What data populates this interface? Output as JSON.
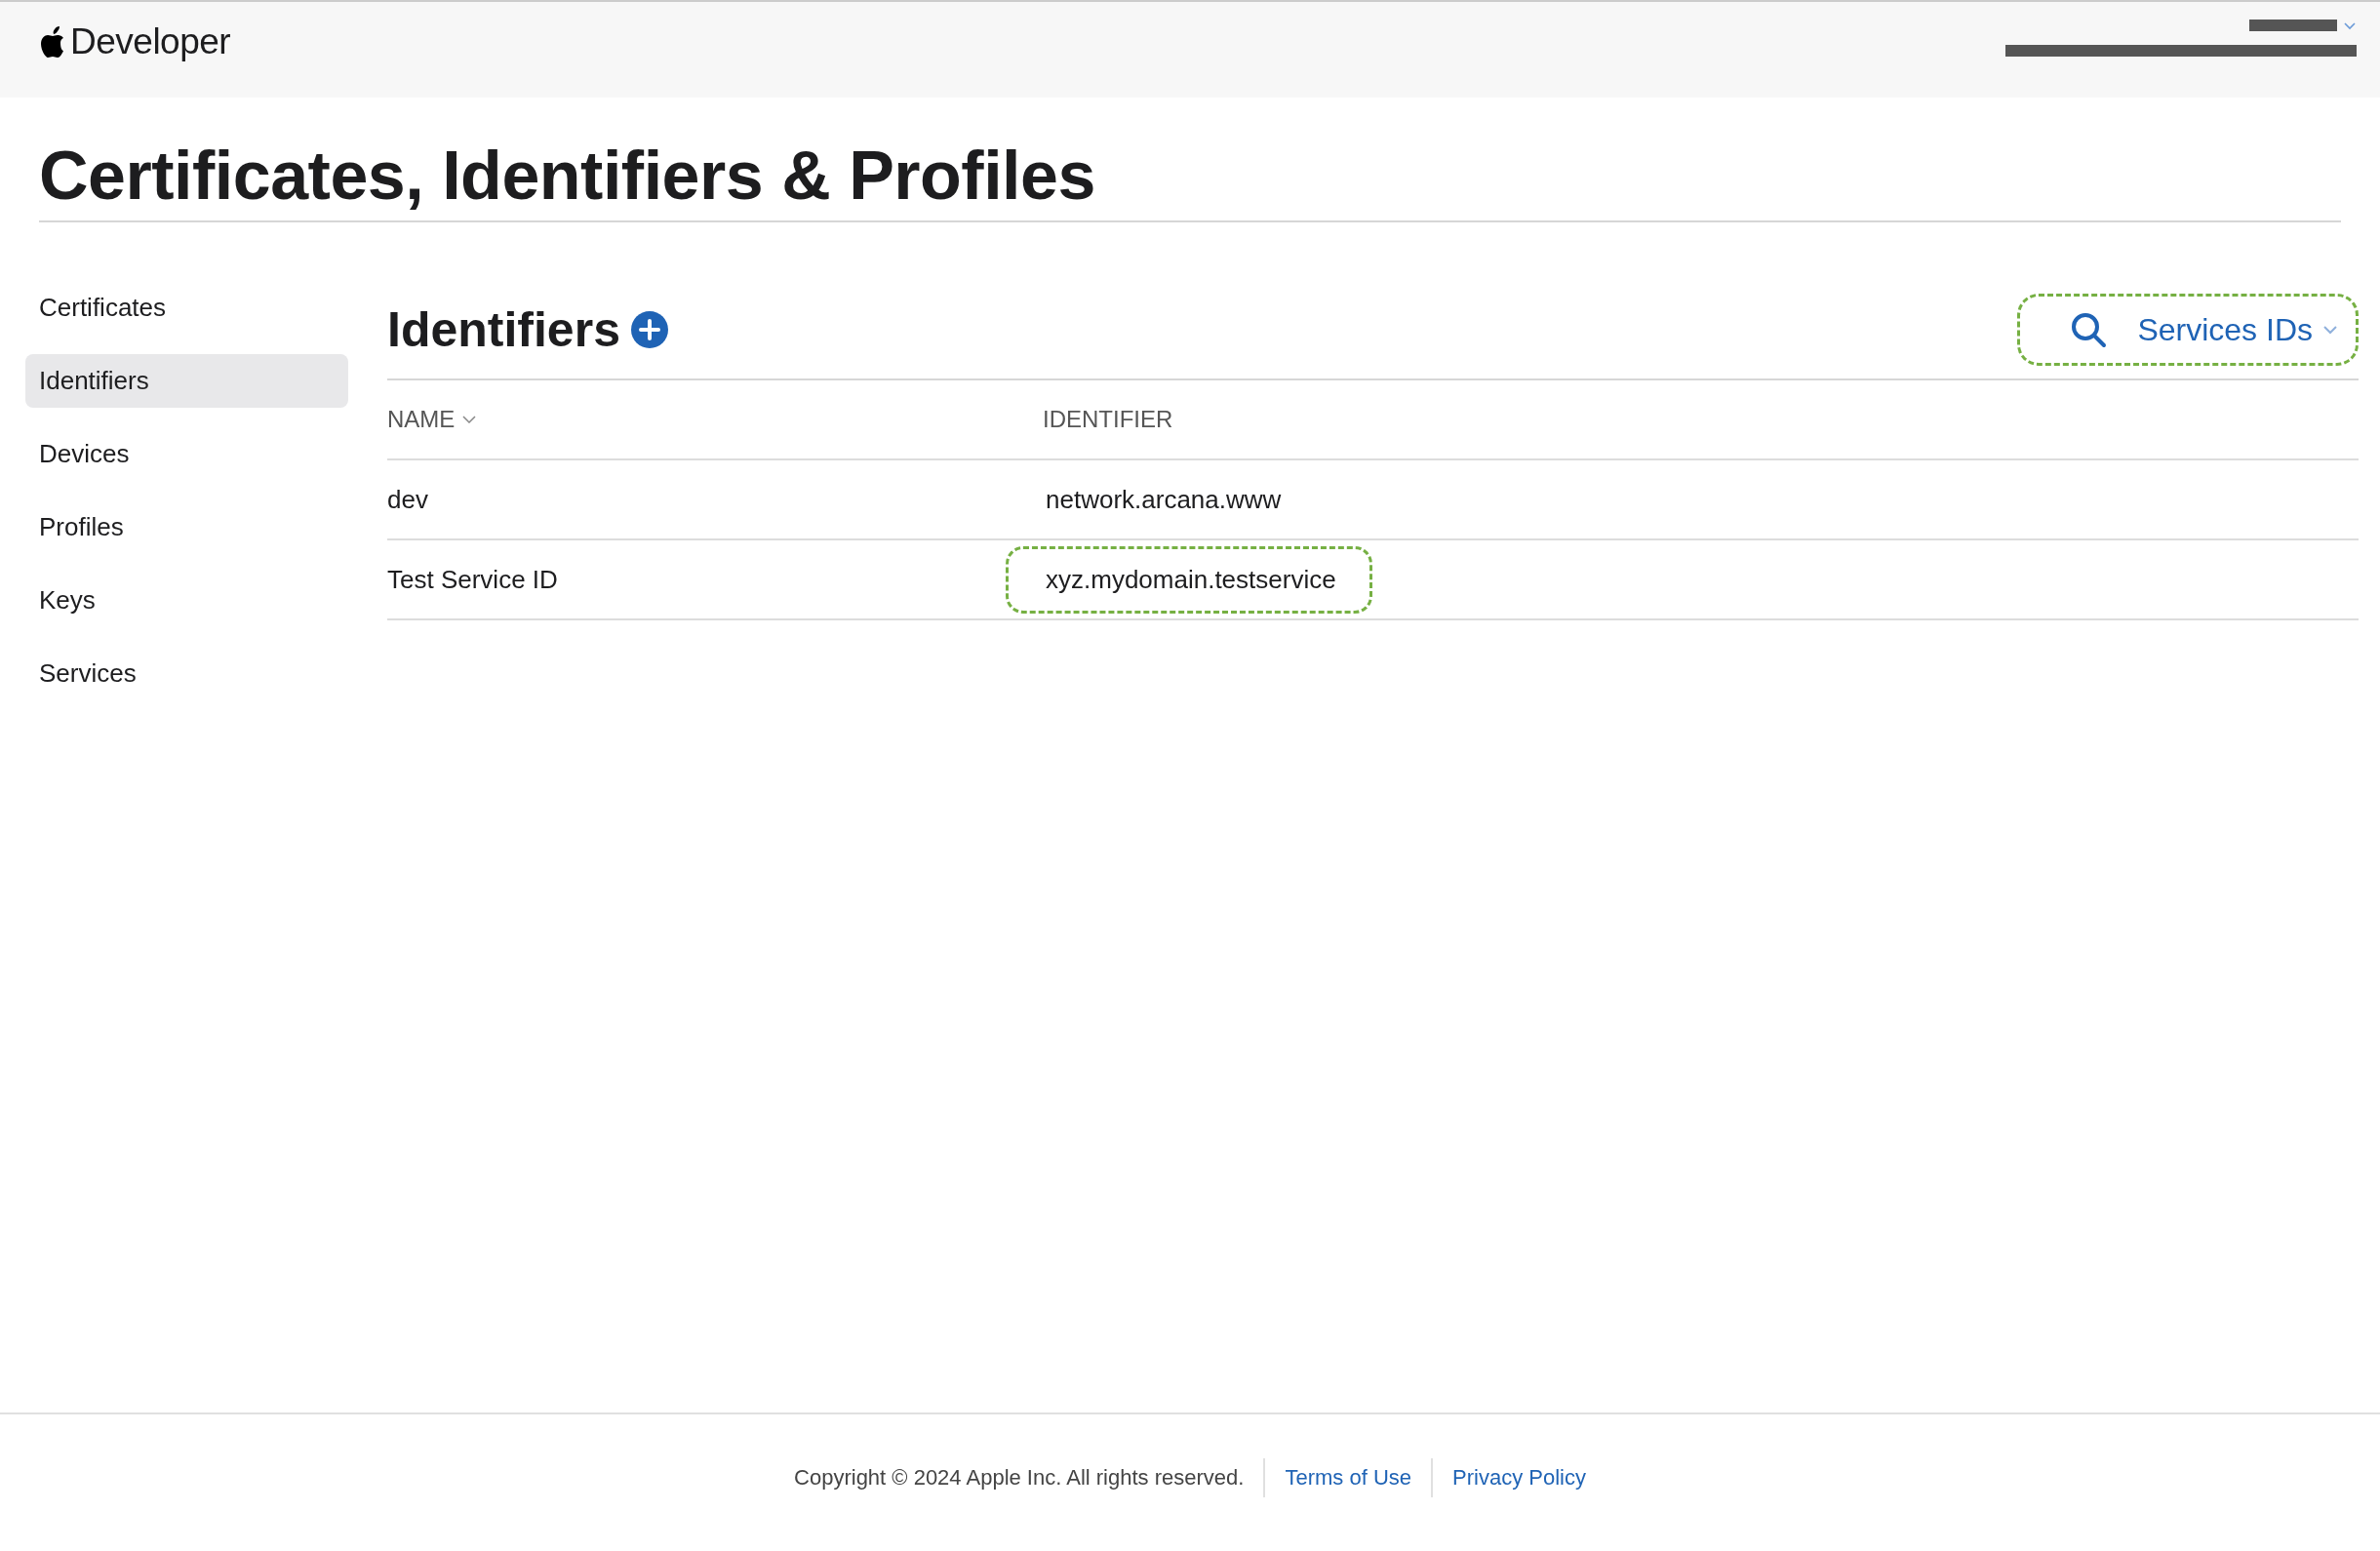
{
  "header": {
    "brand": "Developer"
  },
  "page_title": "Certificates, Identifiers & Profiles",
  "sidebar": {
    "items": [
      {
        "label": "Certificates",
        "selected": false
      },
      {
        "label": "Identifiers",
        "selected": true
      },
      {
        "label": "Devices",
        "selected": false
      },
      {
        "label": "Profiles",
        "selected": false
      },
      {
        "label": "Keys",
        "selected": false
      },
      {
        "label": "Services",
        "selected": false
      }
    ]
  },
  "section": {
    "title": "Identifiers",
    "filter": {
      "label": "Services IDs",
      "highlighted": true
    }
  },
  "table": {
    "columns": [
      {
        "label": "NAME",
        "sortable": true
      },
      {
        "label": "IDENTIFIER",
        "sortable": false
      }
    ],
    "rows": [
      {
        "name": "dev",
        "identifier": "network.arcana.www",
        "highlighted": false
      },
      {
        "name": "Test Service ID",
        "identifier": "xyz.mydomain.testservice",
        "highlighted": true
      }
    ]
  },
  "footer": {
    "copyright": "Copyright © 2024 Apple Inc. All rights reserved.",
    "links": [
      "Terms of Use",
      "Privacy Policy"
    ]
  }
}
